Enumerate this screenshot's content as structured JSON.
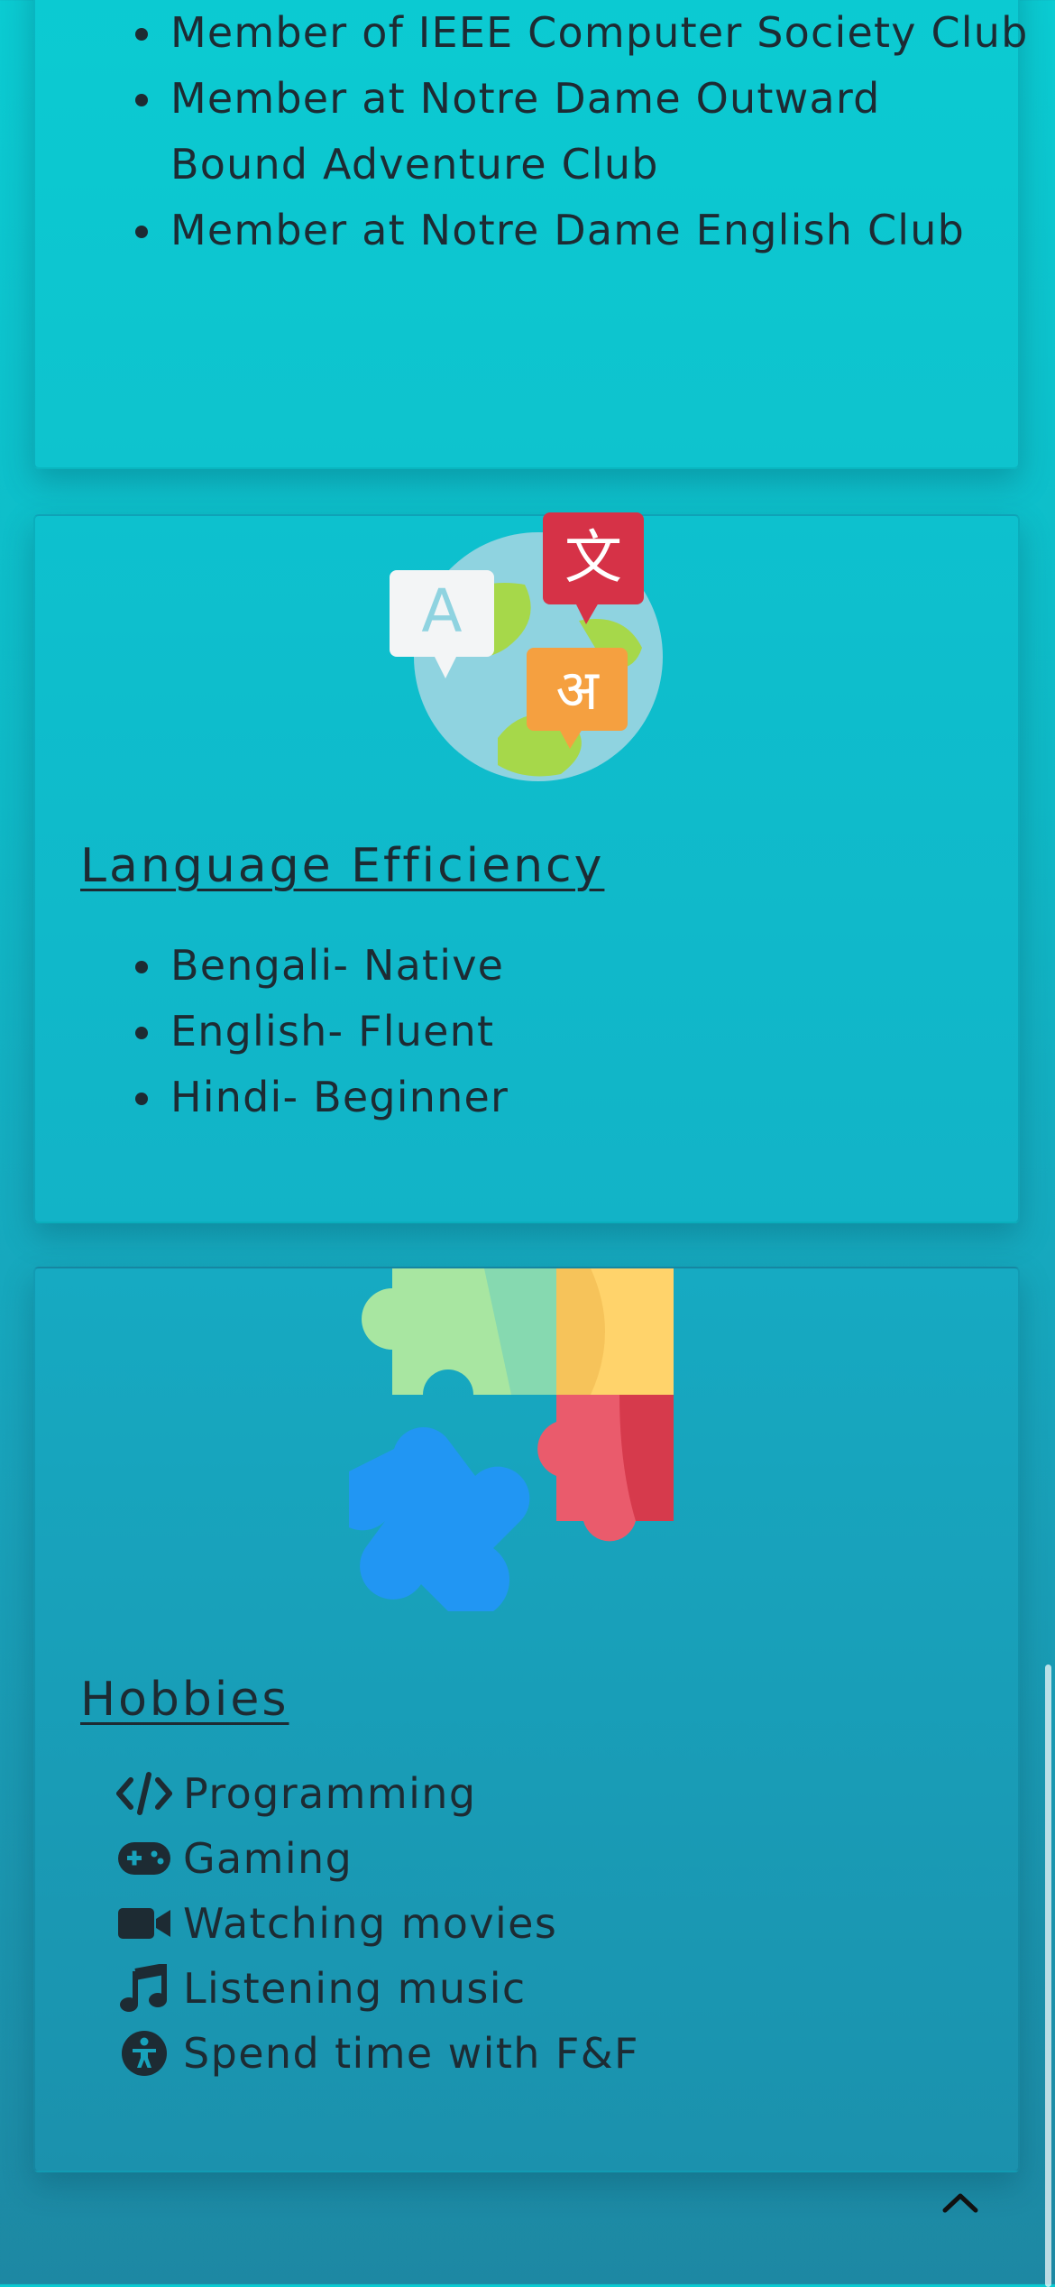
{
  "activities": {
    "items": [
      "Member of IEEE Computer Society Club",
      "Member at Notre Dame Outward Bound Adventure Club",
      "Member at Notre Dame English Club"
    ]
  },
  "language": {
    "title": "Language Efficiency",
    "illustration_glyphs": {
      "latin": "A",
      "chinese": "文",
      "hindi": "अ"
    },
    "items": [
      "Bengali- Native",
      "English- Fluent",
      "Hindi- Beginner"
    ]
  },
  "hobbies": {
    "title": "Hobbies",
    "items": [
      {
        "icon": "code-icon",
        "label": "Programming"
      },
      {
        "icon": "gamepad-icon",
        "label": "Gaming"
      },
      {
        "icon": "video-camera-icon",
        "label": "Watching movies"
      },
      {
        "icon": "music-note-icon",
        "label": "Listening music"
      },
      {
        "icon": "person-circle-icon",
        "label": "Spend time with F&F"
      }
    ]
  },
  "colors": {
    "background_top": "#0bcbd2",
    "background_bottom": "#1d88a3",
    "text": "#1d2b33"
  }
}
